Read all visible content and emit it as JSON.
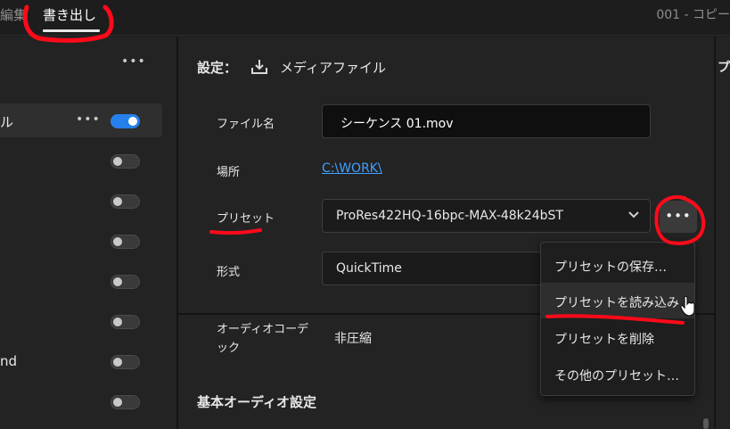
{
  "topbar": {
    "tab_edit": "編集",
    "tab_export": "書き出し",
    "document_title": "001 - コピー"
  },
  "left_panel": {
    "rows": [
      {
        "label": "ル",
        "on": true
      },
      {
        "label": "",
        "on": false
      },
      {
        "label": "",
        "on": false
      },
      {
        "label": "",
        "on": false
      },
      {
        "label": "",
        "on": false
      },
      {
        "label": "",
        "on": false
      },
      {
        "label": "nd",
        "on": false
      },
      {
        "label": "",
        "on": false
      }
    ],
    "more_glyph": "•••"
  },
  "settings": {
    "heading": "設定：",
    "media_label": "メディアファイル",
    "filename_label": "ファイル名",
    "filename_value": "シーケンス 01.mov",
    "location_label": "場所",
    "location_value": "C:\\WORK\\",
    "preset_label": "プリセット",
    "preset_value": "ProRes422HQ-16bpc-MAX-48k24bST",
    "preset_more": "•••",
    "format_label": "形式",
    "format_value": "QuickTime",
    "audio_codec_label": "オーディオコーデック",
    "audio_codec_value": "非圧縮",
    "basic_audio_heading": "基本オーディオ設定"
  },
  "right_strip": {
    "text": "プ"
  },
  "preset_menu": {
    "items": [
      "プリセットの保存…",
      "プリセットを読み込み…",
      "プリセットを削除",
      "その他のプリセット…"
    ],
    "hover_index": 1
  },
  "colors": {
    "accent": "#2680eb",
    "link": "#3fa0ff",
    "annotation": "#ff0a1a"
  }
}
